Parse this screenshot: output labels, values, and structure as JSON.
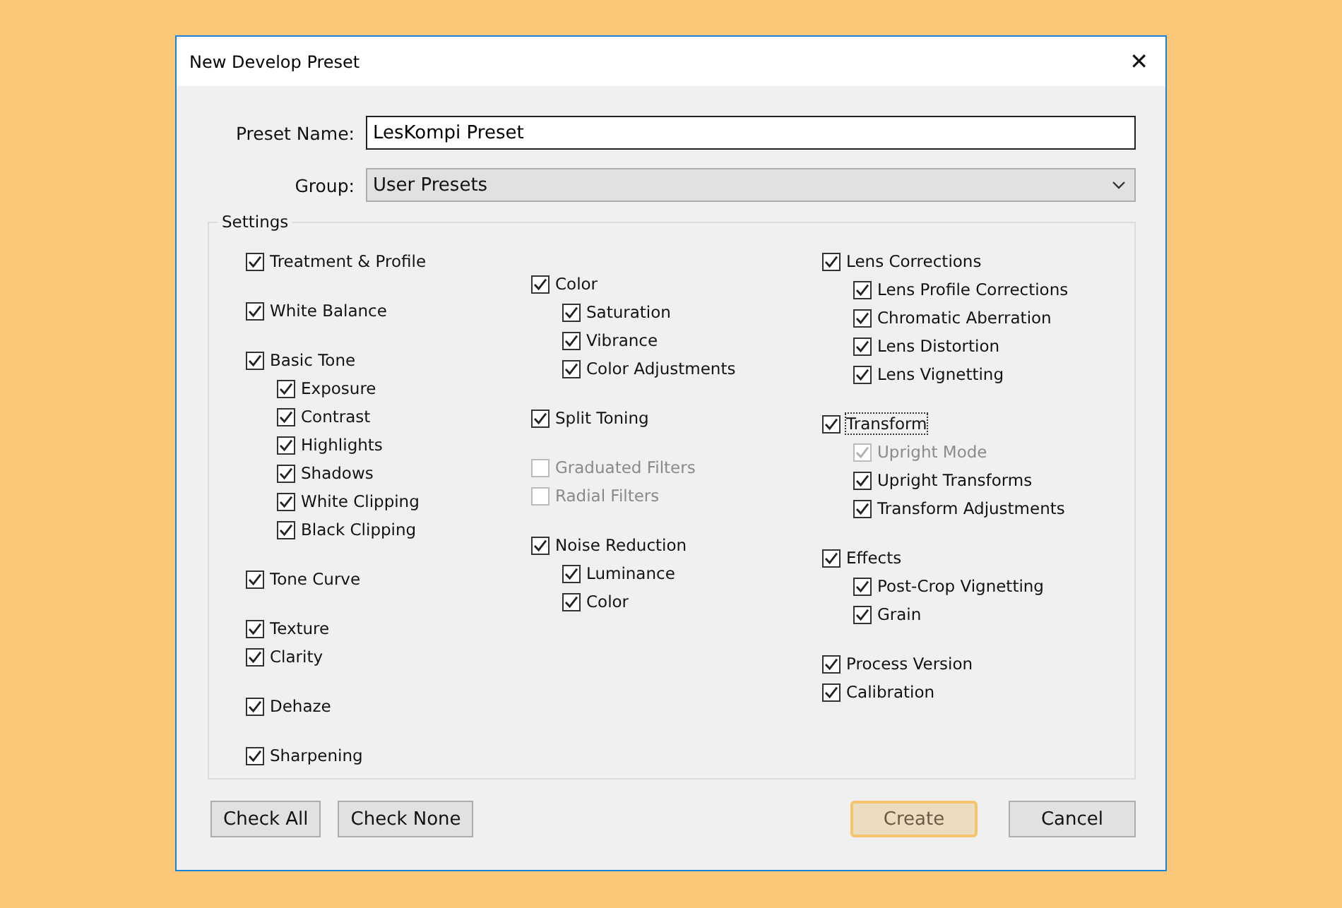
{
  "window": {
    "title": "New Develop Preset",
    "close": "✕"
  },
  "preset_name": {
    "label": "Preset Name:",
    "value": "LesKompi Preset"
  },
  "group": {
    "label": "Group:",
    "value": "User Presets"
  },
  "settings": {
    "title": "Settings",
    "columns": [
      {
        "offset": false,
        "groups": [
          [
            {
              "label": "Treatment & Profile",
              "checked": true,
              "disabled": false,
              "focused": false
            }
          ],
          [
            {
              "label": "White Balance",
              "checked": true,
              "disabled": false,
              "focused": false
            }
          ],
          [
            {
              "label": "Basic Tone",
              "checked": true,
              "disabled": false,
              "focused": false,
              "children": [
                {
                  "label": "Exposure",
                  "checked": true,
                  "disabled": false,
                  "focused": false
                },
                {
                  "label": "Contrast",
                  "checked": true,
                  "disabled": false,
                  "focused": false
                },
                {
                  "label": "Highlights",
                  "checked": true,
                  "disabled": false,
                  "focused": false
                },
                {
                  "label": "Shadows",
                  "checked": true,
                  "disabled": false,
                  "focused": false
                },
                {
                  "label": "White Clipping",
                  "checked": true,
                  "disabled": false,
                  "focused": false
                },
                {
                  "label": "Black Clipping",
                  "checked": true,
                  "disabled": false,
                  "focused": false
                }
              ]
            }
          ],
          [
            {
              "label": "Tone Curve",
              "checked": true,
              "disabled": false,
              "focused": false
            }
          ],
          [
            {
              "label": "Texture",
              "checked": true,
              "disabled": false,
              "focused": false
            },
            {
              "label": "Clarity",
              "checked": true,
              "disabled": false,
              "focused": false
            }
          ],
          [
            {
              "label": "Dehaze",
              "checked": true,
              "disabled": false,
              "focused": false
            }
          ],
          [
            {
              "label": "Sharpening",
              "checked": true,
              "disabled": false,
              "focused": false
            }
          ]
        ]
      },
      {
        "offset": true,
        "groups": [
          [
            {
              "label": "Color",
              "checked": true,
              "disabled": false,
              "focused": false,
              "children": [
                {
                  "label": "Saturation",
                  "checked": true,
                  "disabled": false,
                  "focused": false
                },
                {
                  "label": "Vibrance",
                  "checked": true,
                  "disabled": false,
                  "focused": false
                },
                {
                  "label": "Color Adjustments",
                  "checked": true,
                  "disabled": false,
                  "focused": false
                }
              ]
            }
          ],
          [
            {
              "label": "Split Toning",
              "checked": true,
              "disabled": false,
              "focused": false
            }
          ],
          [
            {
              "label": "Graduated Filters",
              "checked": false,
              "disabled": true,
              "focused": false
            },
            {
              "label": "Radial Filters",
              "checked": false,
              "disabled": true,
              "focused": false
            }
          ],
          [
            {
              "label": "Noise Reduction",
              "checked": true,
              "disabled": false,
              "focused": false,
              "children": [
                {
                  "label": "Luminance",
                  "checked": true,
                  "disabled": false,
                  "focused": false
                },
                {
                  "label": "Color",
                  "checked": true,
                  "disabled": false,
                  "focused": false
                }
              ]
            }
          ]
        ]
      },
      {
        "offset": false,
        "groups": [
          [
            {
              "label": "Lens Corrections",
              "checked": true,
              "disabled": false,
              "focused": false,
              "children": [
                {
                  "label": "Lens Profile Corrections",
                  "checked": true,
                  "disabled": false,
                  "focused": false
                },
                {
                  "label": "Chromatic Aberration",
                  "checked": true,
                  "disabled": false,
                  "focused": false
                },
                {
                  "label": "Lens Distortion",
                  "checked": true,
                  "disabled": false,
                  "focused": false
                },
                {
                  "label": "Lens Vignetting",
                  "checked": true,
                  "disabled": false,
                  "focused": false
                }
              ]
            }
          ],
          [
            {
              "label": "Transform",
              "checked": true,
              "disabled": false,
              "focused": true,
              "children": [
                {
                  "label": "Upright Mode",
                  "checked": true,
                  "disabled": true,
                  "focused": false
                },
                {
                  "label": "Upright Transforms",
                  "checked": true,
                  "disabled": false,
                  "focused": false
                },
                {
                  "label": "Transform Adjustments",
                  "checked": true,
                  "disabled": false,
                  "focused": false
                }
              ]
            }
          ],
          [
            {
              "label": "Effects",
              "checked": true,
              "disabled": false,
              "focused": false,
              "children": [
                {
                  "label": "Post-Crop Vignetting",
                  "checked": true,
                  "disabled": false,
                  "focused": false
                },
                {
                  "label": "Grain",
                  "checked": true,
                  "disabled": false,
                  "focused": false
                }
              ]
            }
          ],
          [
            {
              "label": "Process Version",
              "checked": true,
              "disabled": false,
              "focused": false
            },
            {
              "label": "Calibration",
              "checked": true,
              "disabled": false,
              "focused": false
            }
          ]
        ]
      }
    ]
  },
  "buttons_left": [
    {
      "label": "Check All",
      "focused": false
    },
    {
      "label": "Check None",
      "focused": false
    }
  ],
  "buttons_right": [
    {
      "label": "Create",
      "focused": true
    },
    {
      "label": "Cancel",
      "focused": false
    }
  ]
}
